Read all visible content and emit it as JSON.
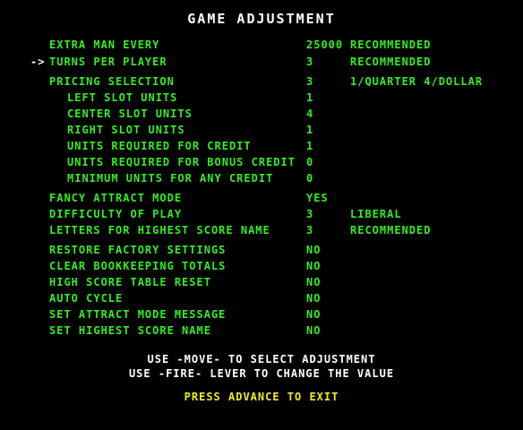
{
  "title": "GAME ADJUSTMENT",
  "cursor": "->",
  "rows": [
    {
      "label": "EXTRA MAN EVERY",
      "value": "25000",
      "note": "RECOMMENDED"
    },
    {
      "label": "TURNS PER PLAYER",
      "value": "3",
      "note": "RECOMMENDED"
    },
    {
      "label": "PRICING SELECTION",
      "value": "3",
      "note": "1/QUARTER 4/DOLLAR"
    },
    {
      "label": "LEFT SLOT UNITS",
      "value": "1",
      "note": ""
    },
    {
      "label": "CENTER SLOT UNITS",
      "value": "4",
      "note": ""
    },
    {
      "label": "RIGHT SLOT UNITS",
      "value": "1",
      "note": ""
    },
    {
      "label": "UNITS REQUIRED FOR CREDIT",
      "value": "1",
      "note": ""
    },
    {
      "label": "UNITS REQUIRED FOR BONUS CREDIT",
      "value": "0",
      "note": ""
    },
    {
      "label": "MINIMUM UNITS FOR ANY CREDIT",
      "value": "0",
      "note": ""
    },
    {
      "label": "FANCY ATTRACT MODE",
      "value": "YES",
      "note": ""
    },
    {
      "label": "DIFFICULTY OF PLAY",
      "value": "3",
      "note": "LIBERAL"
    },
    {
      "label": "LETTERS FOR HIGHEST SCORE NAME",
      "value": "3",
      "note": "RECOMMENDED"
    },
    {
      "label": "RESTORE FACTORY SETTINGS",
      "value": "NO",
      "note": ""
    },
    {
      "label": "CLEAR BOOKKEEPING TOTALS",
      "value": "NO",
      "note": ""
    },
    {
      "label": "HIGH SCORE TABLE RESET",
      "value": "NO",
      "note": ""
    },
    {
      "label": "AUTO CYCLE",
      "value": "NO",
      "note": ""
    },
    {
      "label": "SET ATTRACT MODE MESSAGE",
      "value": "NO",
      "note": ""
    },
    {
      "label": "SET HIGHEST SCORE NAME",
      "value": "NO",
      "note": ""
    }
  ],
  "instructions": {
    "line1": "USE -MOVE- TO SELECT ADJUSTMENT",
    "line2": "USE -FIRE- LEVER TO CHANGE THE VALUE"
  },
  "exit_text": "PRESS ADVANCE TO EXIT",
  "colors": {
    "background": "#000000",
    "title": "#ffffff",
    "menu_text": "#33ee22",
    "instructions": "#ffffff",
    "exit_prompt": "#eeee22"
  }
}
